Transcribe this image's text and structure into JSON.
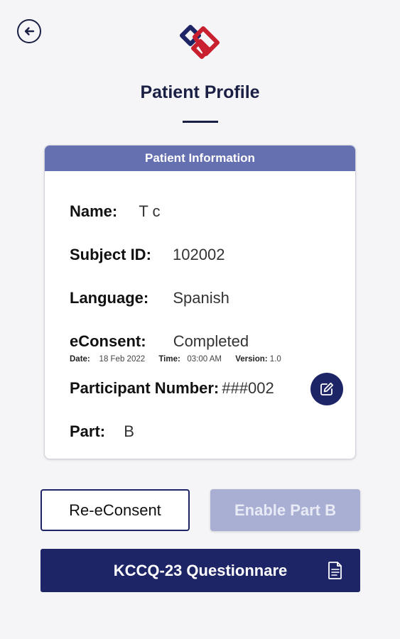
{
  "header": {
    "title": "Patient Profile",
    "back_icon": "arrow-left-icon",
    "logo_icon": "heart-link-logo"
  },
  "card": {
    "header": "Patient Information",
    "name_label": "Name:",
    "name_value": "T c",
    "subject_label": "Subject ID:",
    "subject_value": "102002",
    "language_label": "Language:",
    "language_value": "Spanish",
    "econsent_label": "eConsent:",
    "econsent_value": "Completed",
    "date_label": "Date:",
    "date_value": "18 Feb 2022",
    "time_label": "Time:",
    "time_value": "03:00 AM",
    "version_label": "Version:",
    "version_value": "1.0",
    "participant_label": "Participant Number:",
    "participant_value": "###002",
    "part_label": "Part:",
    "part_value": "B",
    "edit_icon": "edit-icon"
  },
  "buttons": {
    "reconsent": "Re-eConsent",
    "enable_part": "Enable Part B",
    "questionnaire": "KCCQ-23 Questionnare",
    "questionnaire_icon": "document-icon"
  },
  "colors": {
    "primary": "#1e2566",
    "header_band": "#6570b0",
    "disabled": "#a9afd3",
    "logo_navy": "#1e2566",
    "logo_red": "#c8202f"
  }
}
